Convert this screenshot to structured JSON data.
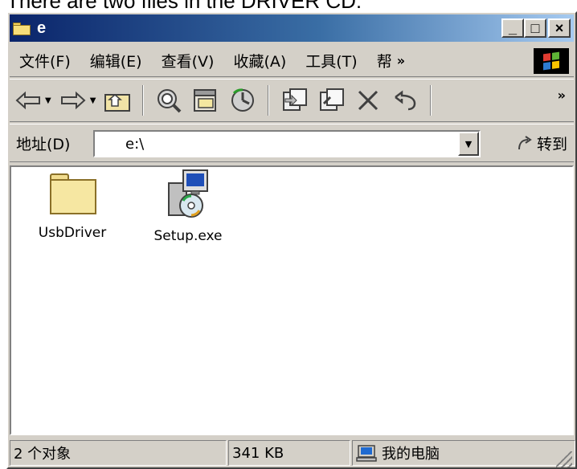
{
  "caption": "There are two files in the DRIVER CD:",
  "window": {
    "title": "e",
    "buttons": {
      "minimize": "_",
      "maximize": "□",
      "close": "×"
    }
  },
  "menu": {
    "items": [
      "文件(F)",
      "编辑(E)",
      "查看(V)",
      "收藏(A)",
      "工具(T)",
      "帮"
    ],
    "more": "»"
  },
  "toolbar": {
    "icons": [
      "back-icon",
      "forward-icon",
      "up-folder-icon",
      "search-icon",
      "folders-icon",
      "history-icon",
      "move-to-icon",
      "copy-to-icon",
      "delete-icon",
      "undo-icon"
    ],
    "more": "»"
  },
  "address": {
    "label": "地址(D)",
    "value": "e:\\",
    "go_label": "转到"
  },
  "files": [
    {
      "name": "UsbDriver",
      "type": "folder"
    },
    {
      "name": "Setup.exe",
      "type": "installer"
    }
  ],
  "status": {
    "objects": "2 个对象",
    "size": "341 KB",
    "location": "我的电脑"
  },
  "colors": {
    "title_start": "#0a246a",
    "title_end": "#a6caf0",
    "chrome": "#d4d0c8"
  }
}
